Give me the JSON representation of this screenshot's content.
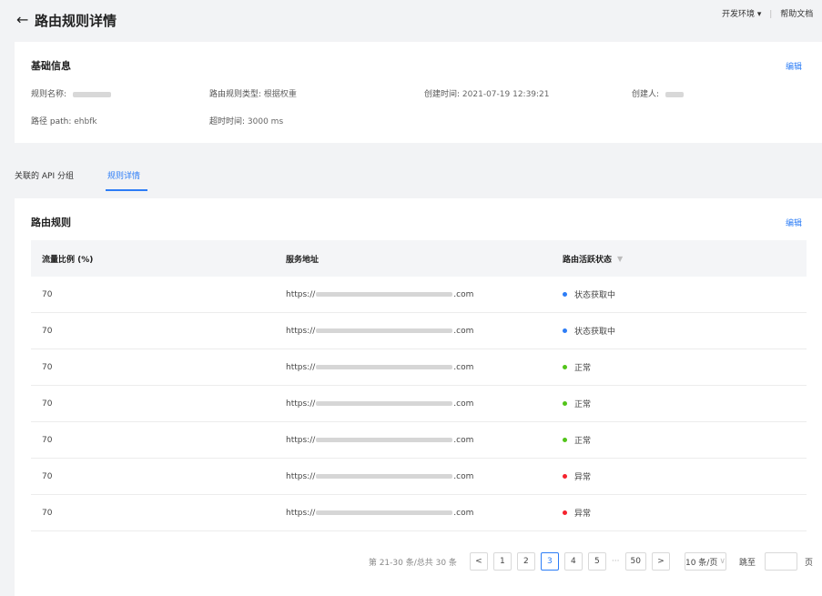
{
  "header": {
    "back_icon": "arrow-left-icon",
    "title": "路由规则详情",
    "env_label": "开发环境",
    "env_chevron": "▾",
    "separator": "|",
    "help_label": "帮助文档"
  },
  "basic": {
    "title": "基础信息",
    "edit_label": "编辑",
    "rule_name_label": "规则名称:",
    "rule_type_label": "路由规则类型:",
    "rule_type_value": "根据权重",
    "created_time_label": "创建时间:",
    "created_time_value": "2021-07-19 12:39:21",
    "creator_label": "创建人:",
    "path_label": "路径 path:",
    "path_value": "ehbfk",
    "timeout_label": "超时时间:",
    "timeout_value": "3000 ms"
  },
  "tabs": [
    {
      "label": "关联的 API 分组",
      "active": false
    },
    {
      "label": "规则详情",
      "active": true
    }
  ],
  "rules": {
    "title": "路由规则",
    "edit_label": "编辑",
    "columns": [
      "流量比例 (%)",
      "服务地址",
      "路由活跃状态"
    ],
    "filter_icon": "filter-icon",
    "rows": [
      {
        "ratio": "70",
        "url_prefix": "https://",
        "url_suffix": ".com",
        "status": "状态获取中",
        "status_color": "#2d7df6"
      },
      {
        "ratio": "70",
        "url_prefix": "https://",
        "url_suffix": ".com",
        "status": "状态获取中",
        "status_color": "#2d7df6"
      },
      {
        "ratio": "70",
        "url_prefix": "https://",
        "url_suffix": ".com",
        "status": "正常",
        "status_color": "#52c41a"
      },
      {
        "ratio": "70",
        "url_prefix": "https://",
        "url_suffix": ".com",
        "status": "正常",
        "status_color": "#52c41a"
      },
      {
        "ratio": "70",
        "url_prefix": "https://",
        "url_suffix": ".com",
        "status": "正常",
        "status_color": "#52c41a"
      },
      {
        "ratio": "70",
        "url_prefix": "https://",
        "url_suffix": ".com",
        "status": "异常",
        "status_color": "#f5222d"
      },
      {
        "ratio": "70",
        "url_prefix": "https://",
        "url_suffix": ".com",
        "status": "异常",
        "status_color": "#f5222d"
      }
    ]
  },
  "pagination": {
    "total_text": "第 21-30 条/总共 30 条",
    "prev": "<",
    "next": ">",
    "pages": [
      "1",
      "2",
      "3",
      "4",
      "5"
    ],
    "active_page": "3",
    "ellipsis": "···",
    "last_page": "50",
    "page_size": "10 条/页",
    "page_size_chevron": "∨",
    "jump_label": "跳至",
    "page_unit": "页"
  },
  "colors": {
    "accent": "#2d7df6",
    "status_loading": "#2d7df6",
    "status_ok": "#52c41a",
    "status_error": "#f5222d"
  }
}
